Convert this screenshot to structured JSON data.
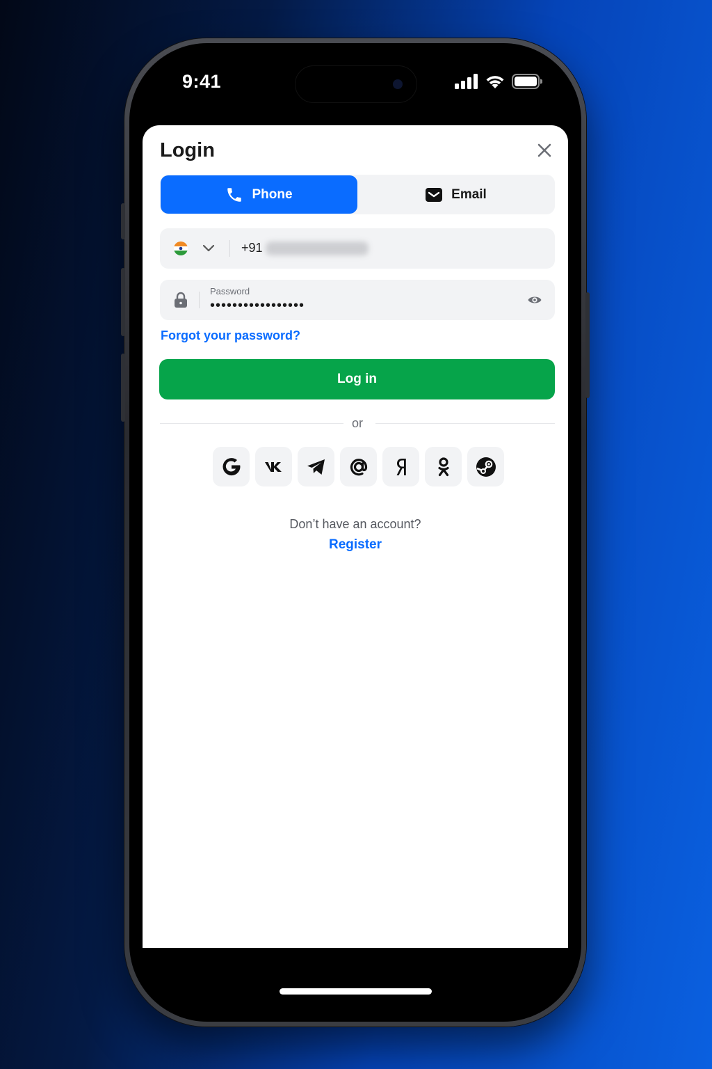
{
  "status_bar": {
    "time": "9:41"
  },
  "sheet": {
    "title": "Login"
  },
  "tabs": [
    {
      "label": "Phone",
      "icon": "phone-icon",
      "active": true
    },
    {
      "label": "Email",
      "icon": "mail-icon",
      "active": false
    }
  ],
  "phone_field": {
    "country_flag": "india-flag-icon",
    "dial_code": "+91"
  },
  "password_field": {
    "label": "Password",
    "value_masked": "•••••••••••••••••"
  },
  "links": {
    "forgot_password": "Forgot your password?"
  },
  "login_button": {
    "label": "Log in"
  },
  "divider": {
    "text": "or"
  },
  "social_logins": [
    {
      "name": "google-icon"
    },
    {
      "name": "vk-icon"
    },
    {
      "name": "telegram-icon"
    },
    {
      "name": "mail-ru-icon"
    },
    {
      "name": "yandex-icon"
    },
    {
      "name": "odnoklassniki-icon"
    },
    {
      "name": "steam-icon"
    }
  ],
  "footer": {
    "no_account": "Don’t have an account?",
    "register": "Register"
  },
  "colors": {
    "accent_blue": "#0a6cff",
    "login_green": "#06a44a",
    "field_bg": "#f2f3f5"
  }
}
